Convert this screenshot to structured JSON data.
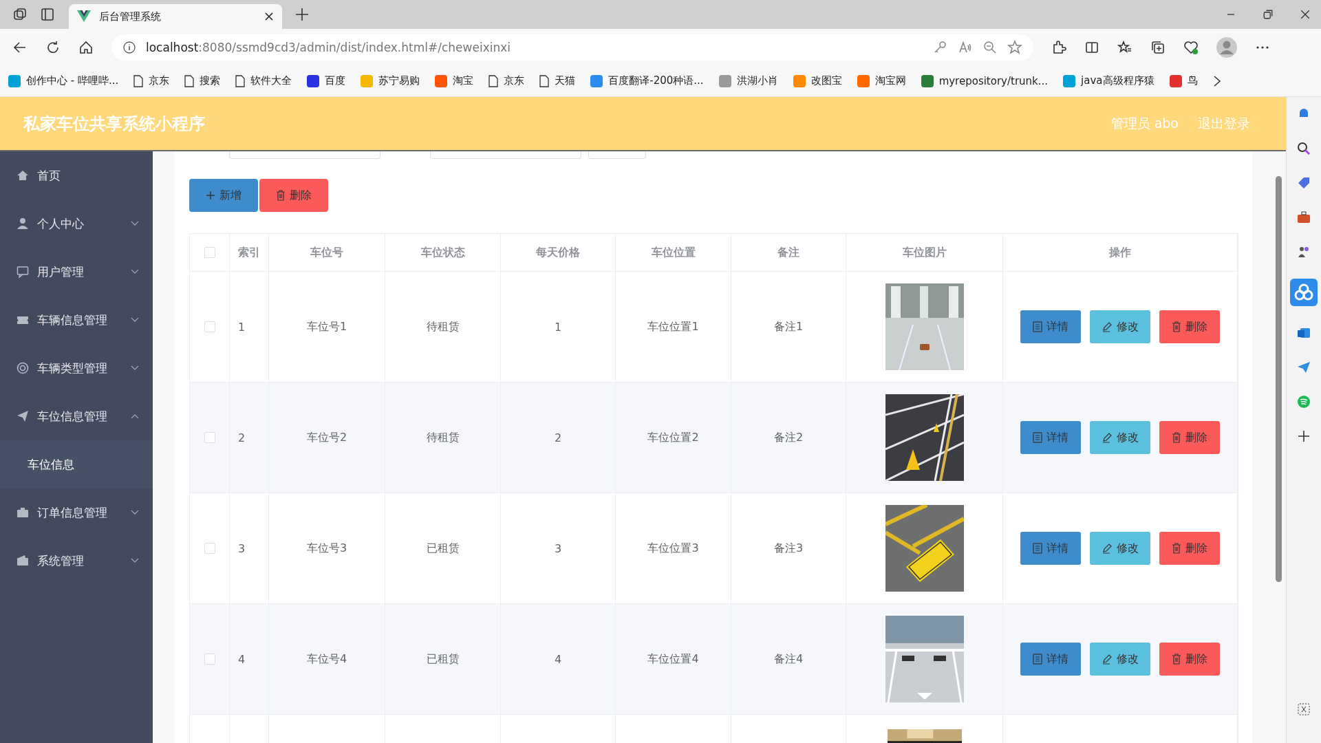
{
  "browser": {
    "tab_title": "后台管理系统",
    "url_host": "localhost",
    "url_rest": ":8080/ssmd9cd3/admin/dist/index.html#/cheweixinxi",
    "bookmarks": [
      {
        "label": "创作中心 - 哔哩哔...",
        "kind": "site",
        "color": "#00a1d6"
      },
      {
        "label": "京东",
        "kind": "page"
      },
      {
        "label": "搜索",
        "kind": "page"
      },
      {
        "label": "软件大全",
        "kind": "page"
      },
      {
        "label": "百度",
        "kind": "site",
        "color": "#2932e1"
      },
      {
        "label": "苏宁易购",
        "kind": "site",
        "color": "#f5b800"
      },
      {
        "label": "淘宝",
        "kind": "site",
        "color": "#ff5500"
      },
      {
        "label": "京东",
        "kind": "page"
      },
      {
        "label": "天猫",
        "kind": "page"
      },
      {
        "label": "百度翻译-200种语...",
        "kind": "site",
        "color": "#2d8cf0"
      },
      {
        "label": "洪湖小肖",
        "kind": "site",
        "color": "#9a9a9a"
      },
      {
        "label": "改图宝",
        "kind": "site",
        "color": "#ff8a00"
      },
      {
        "label": "淘宝网",
        "kind": "site",
        "color": "#ff6a00"
      },
      {
        "label": "myrepository/trunk...",
        "kind": "site",
        "color": "#2a7d3a"
      },
      {
        "label": "java高级程序猿",
        "kind": "site",
        "color": "#00a1d6"
      },
      {
        "label": "鸟",
        "kind": "site",
        "color": "#e03030"
      }
    ]
  },
  "app": {
    "title": "私家车位共享系统小程序",
    "user": "管理员 abo",
    "logout": "退出登录"
  },
  "sidebar": {
    "items": [
      {
        "label": "首页",
        "kind": "link"
      },
      {
        "label": "个人中心",
        "kind": "group",
        "expanded": false
      },
      {
        "label": "用户管理",
        "kind": "group",
        "expanded": false
      },
      {
        "label": "车辆信息管理",
        "kind": "group",
        "expanded": false
      },
      {
        "label": "车辆类型管理",
        "kind": "group",
        "expanded": false
      },
      {
        "label": "车位信息管理",
        "kind": "group",
        "expanded": true,
        "children": [
          {
            "label": "车位信息",
            "selected": true
          }
        ]
      },
      {
        "label": "订单信息管理",
        "kind": "group",
        "expanded": false
      },
      {
        "label": "系统管理",
        "kind": "group",
        "expanded": false
      }
    ]
  },
  "toolbar": {
    "add": "新增",
    "delete": "删除"
  },
  "table": {
    "columns": [
      "索引",
      "车位号",
      "车位状态",
      "每天价格",
      "车位位置",
      "备注",
      "车位图片",
      "操作"
    ],
    "header_checked": false,
    "rows": [
      {
        "checked": false,
        "index": "1",
        "number": "车位号1",
        "status": "待租赁",
        "price": "1",
        "location": "车位位置1",
        "note": "备注1",
        "picture": {
          "kind": "picture"
        },
        "actions": [
          "详情",
          "修改",
          "删除"
        ]
      },
      {
        "checked": false,
        "index": "2",
        "number": "车位号2",
        "status": "待租赁",
        "price": "2",
        "location": "车位位置2",
        "note": "备注2",
        "picture": {
          "kind": "picture"
        },
        "actions": [
          "详情",
          "修改",
          "删除"
        ]
      },
      {
        "checked": false,
        "index": "3",
        "number": "车位号3",
        "status": "已租赁",
        "price": "3",
        "location": "车位位置3",
        "note": "备注3",
        "picture": {
          "kind": "picture"
        },
        "actions": [
          "详情",
          "修改",
          "删除"
        ]
      },
      {
        "checked": false,
        "index": "4",
        "number": "车位号4",
        "status": "已租赁",
        "price": "4",
        "location": "车位位置4",
        "note": "备注4",
        "picture": {
          "kind": "picture"
        },
        "actions": [
          "详情",
          "修改",
          "删除"
        ]
      }
    ]
  }
}
